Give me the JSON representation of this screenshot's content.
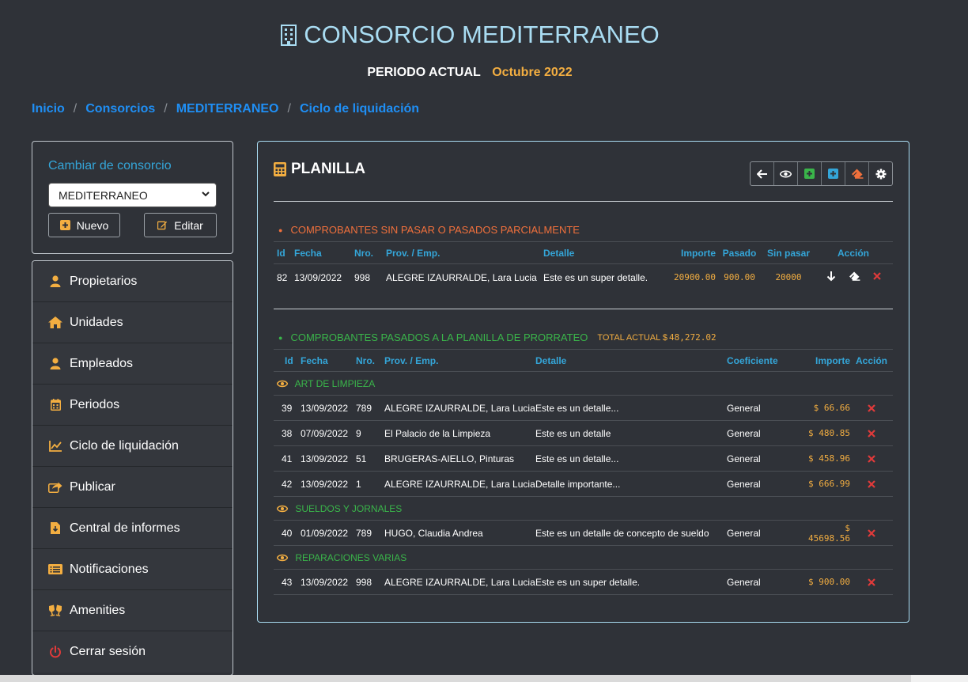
{
  "header": {
    "title": "CONSORCIO MEDITERRANEO",
    "title_icon": "building-icon",
    "periodo_label": "PERIODO ACTUAL",
    "periodo_value": "Octubre 2022"
  },
  "breadcrumb": [
    "Inicio",
    "Consorcios",
    "MEDITERRANEO",
    "Ciclo de liquidación"
  ],
  "switcher": {
    "title": "Cambiar de consorcio",
    "selected": "MEDITERRANEO",
    "new_label": "Nuevo",
    "edit_label": "Editar"
  },
  "menu": [
    {
      "label": "Propietarios",
      "icon": "user-icon"
    },
    {
      "label": "Unidades",
      "icon": "home-icon"
    },
    {
      "label": "Empleados",
      "icon": "user-icon"
    },
    {
      "label": "Periodos",
      "icon": "calendar-icon"
    },
    {
      "label": "Ciclo de liquidación",
      "icon": "chart-line-icon"
    },
    {
      "label": "Publicar",
      "icon": "share-icon"
    },
    {
      "label": "Central de informes",
      "icon": "file-download-icon"
    },
    {
      "label": "Notificaciones",
      "icon": "list-icon"
    },
    {
      "label": "Amenities",
      "icon": "glasses-cheers-icon"
    },
    {
      "label": "Cerrar sesión",
      "icon": "power-icon"
    }
  ],
  "panel": {
    "title": "PLANILLA",
    "title_icon": "calculator-icon",
    "toolbar": [
      "back-arrow-icon",
      "eye-icon",
      "plus-square-icon",
      "plus-square-icon",
      "eraser-icon",
      "gear-icon"
    ]
  },
  "pending": {
    "heading": "COMPROBANTES SIN PASAR O PASADOS PARCIALMENTE",
    "columns": [
      "Id",
      "Fecha",
      "Nro.",
      "Prov. / Emp.",
      "Detalle",
      "Importe",
      "Pasado",
      "Sin pasar",
      "Acción"
    ],
    "rows": [
      {
        "id": "82",
        "fecha": "13/09/2022",
        "nro": "998",
        "prov": "ALEGRE IZAURRALDE, Lara Lucia",
        "detalle": "Este es un super detalle.",
        "importe": "20900.00",
        "pasado": "900.00",
        "sin_pasar": "20000"
      }
    ]
  },
  "passed": {
    "heading": "COMPROBANTES PASADOS A LA PLANILLA DE PRORRATEO",
    "total_label": "TOTAL ACTUAL $",
    "total_value": "48,272.02",
    "columns": [
      "Id",
      "Fecha",
      "Nro.",
      "Prov. / Emp.",
      "Detalle",
      "Coeficiente",
      "Importe",
      "Acción"
    ],
    "groups": [
      {
        "name": "ART DE LIMPIEZA",
        "rows": [
          {
            "id": "39",
            "fecha": "13/09/2022",
            "nro": "789",
            "prov": "ALEGRE IZAURRALDE, Lara Lucia",
            "detalle": "Este es un detalle...",
            "coef": "General",
            "importe": "$ 66.66"
          },
          {
            "id": "38",
            "fecha": "07/09/2022",
            "nro": "9",
            "prov": "El Palacio de la Limpieza",
            "detalle": "Este es un detalle",
            "coef": "General",
            "importe": "$ 480.85"
          },
          {
            "id": "41",
            "fecha": "13/09/2022",
            "nro": "51",
            "prov": "BRUGERAS-AIELLO, Pinturas",
            "detalle": "Este es un detalle...",
            "coef": "General",
            "importe": "$ 458.96"
          },
          {
            "id": "42",
            "fecha": "13/09/2022",
            "nro": "1",
            "prov": "ALEGRE IZAURRALDE, Lara Lucia",
            "detalle": "Detalle importante...",
            "coef": "General",
            "importe": "$ 666.99"
          }
        ]
      },
      {
        "name": "SUELDOS Y JORNALES",
        "rows": [
          {
            "id": "40",
            "fecha": "01/09/2022",
            "nro": "789",
            "prov": "HUGO, Claudia Andrea",
            "detalle": "Este es un detalle de concepto de sueldo",
            "coef": "General",
            "importe": "$ 45698.56"
          }
        ]
      },
      {
        "name": "REPARACIONES VARIAS",
        "rows": [
          {
            "id": "43",
            "fecha": "13/09/2022",
            "nro": "998",
            "prov": "ALEGRE IZAURRALDE, Lara Lucia",
            "detalle": "Este es un super detalle.",
            "coef": "General",
            "importe": "$ 900.00"
          }
        ]
      }
    ]
  },
  "colors": {
    "background": "#2f3238",
    "title": "#a9dcf2",
    "accent_blue": "#34a6d9",
    "link": "#1f8ff5",
    "orange": "#f0703c",
    "amount": "#f3ae41",
    "green": "#3ab54a",
    "danger": "#e03a3a"
  }
}
